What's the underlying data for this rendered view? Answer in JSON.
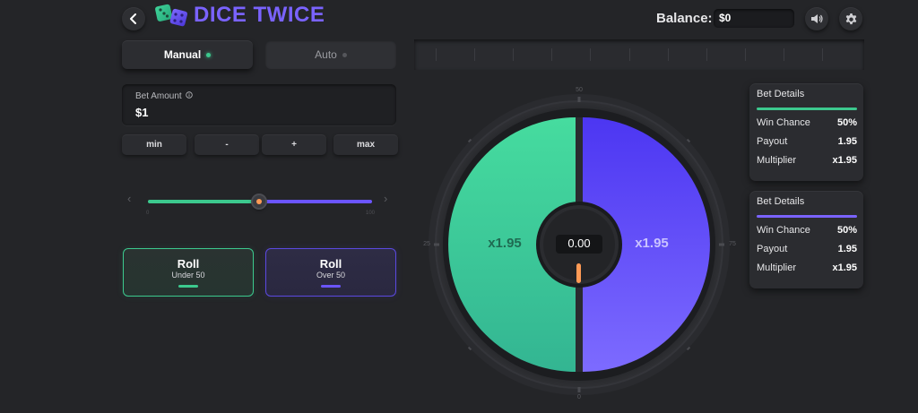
{
  "header": {
    "back_icon": "chevron-left-icon",
    "title": "DICE TWICE",
    "balance_label": "Balance:",
    "balance_value": "$0",
    "sound_icon": "speaker-icon",
    "settings_icon": "gear-icon"
  },
  "mode_tabs": [
    {
      "label": "Manual",
      "active": true
    },
    {
      "label": "Auto",
      "active": false
    }
  ],
  "bet": {
    "label": "Bet Amount",
    "info_icon": "info-icon",
    "value": "$1",
    "buttons": [
      "min",
      "-",
      "+",
      "max"
    ]
  },
  "slider": {
    "level": 50,
    "min": 0,
    "max": 100
  },
  "roll_buttons": [
    {
      "title": "Roll",
      "sub": "Under 50",
      "color": "#3cc98e"
    },
    {
      "title": "Roll",
      "sub": "Over 50",
      "color": "#6b55ff"
    }
  ],
  "wheel": {
    "result": "0.00",
    "left_multiplier": "x1.95",
    "right_multiplier": "x1.95",
    "top_label": "50",
    "left_label": "25",
    "right_label": "75",
    "bottom_label": "0",
    "left_color": "#3fd49a",
    "right_color": "#6a54ff"
  },
  "details": [
    {
      "title": "Bet Details",
      "accent": "#3cc98e",
      "rows": [
        {
          "label": "Win Chance",
          "value": "50%"
        },
        {
          "label": "Payout",
          "value": "1.95"
        },
        {
          "label": "Multiplier",
          "value": "x1.95"
        }
      ]
    },
    {
      "title": "Bet Details",
      "accent": "#7a63ff",
      "rows": [
        {
          "label": "Win Chance",
          "value": "50%"
        },
        {
          "label": "Payout",
          "value": "1.95"
        },
        {
          "label": "Multiplier",
          "value": "x1.95"
        }
      ]
    }
  ]
}
